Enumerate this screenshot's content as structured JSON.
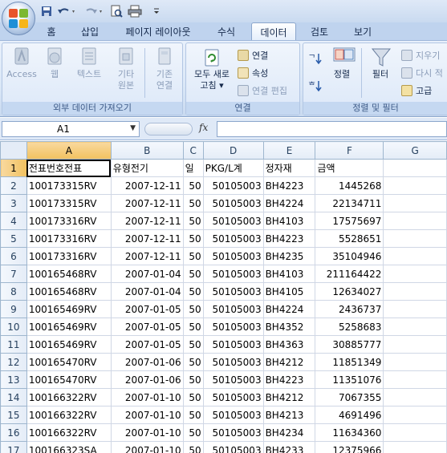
{
  "quick_access": [
    "save-icon",
    "undo-icon",
    "redo-icon",
    "print-preview-icon",
    "quick-print-icon",
    "customize-icon"
  ],
  "tabs": [
    {
      "label": "홈",
      "active": false
    },
    {
      "label": "삽입",
      "active": false
    },
    {
      "label": "페이지 레이아웃",
      "active": false
    },
    {
      "label": "수식",
      "active": false
    },
    {
      "label": "데이터",
      "active": true
    },
    {
      "label": "검토",
      "active": false
    },
    {
      "label": "보기",
      "active": false
    }
  ],
  "ribbon": {
    "external": {
      "label": "외부 데이터 가져오기",
      "access": "Access",
      "web": "웹",
      "text": "텍스트",
      "other_line1": "기타",
      "other_line2": "원본",
      "existing_line1": "기존",
      "existing_line2": "연결"
    },
    "connections": {
      "label": "연결",
      "refresh_line1": "모두 새로",
      "refresh_line2": "고침",
      "conn": "연결",
      "props": "속성",
      "edit_links": "연결 편집"
    },
    "sort": {
      "label": "정렬 및 필터",
      "sort": "정렬",
      "filter": "필터",
      "clear": "지우기",
      "reapply": "다시 적",
      "advanced": "고급"
    }
  },
  "formula_bar": {
    "namebox": "A1",
    "fx": "fx",
    "formula": ""
  },
  "columns": [
    "A",
    "B",
    "C",
    "D",
    "E",
    "F",
    "G"
  ],
  "rows": [
    {
      "n": "1",
      "a": "전표번호전표",
      "b": "유형전기",
      "c": "일",
      "d": "PKG/L계",
      "e": "정자재",
      "f": "금액"
    },
    {
      "n": "2",
      "a": "100173315RV",
      "b": "2007-12-11",
      "c": "50",
      "d": "50105003",
      "e": "BH4223",
      "f": "1445268"
    },
    {
      "n": "3",
      "a": "100173315RV",
      "b": "2007-12-11",
      "c": "50",
      "d": "50105003",
      "e": "BH4224",
      "f": "22134711"
    },
    {
      "n": "4",
      "a": "100173316RV",
      "b": "2007-12-11",
      "c": "50",
      "d": "50105003",
      "e": "BH4103",
      "f": "17575697"
    },
    {
      "n": "5",
      "a": "100173316RV",
      "b": "2007-12-11",
      "c": "50",
      "d": "50105003",
      "e": "BH4223",
      "f": "5528651"
    },
    {
      "n": "6",
      "a": "100173316RV",
      "b": "2007-12-11",
      "c": "50",
      "d": "50105003",
      "e": "BH4235",
      "f": "35104946"
    },
    {
      "n": "7",
      "a": "100165468RV",
      "b": "2007-01-04",
      "c": "50",
      "d": "50105003",
      "e": "BH4103",
      "f": "211164422"
    },
    {
      "n": "8",
      "a": "100165468RV",
      "b": "2007-01-04",
      "c": "50",
      "d": "50105003",
      "e": "BH4105",
      "f": "12634027"
    },
    {
      "n": "9",
      "a": "100165469RV",
      "b": "2007-01-05",
      "c": "50",
      "d": "50105003",
      "e": "BH4224",
      "f": "2436737"
    },
    {
      "n": "10",
      "a": "100165469RV",
      "b": "2007-01-05",
      "c": "50",
      "d": "50105003",
      "e": "BH4352",
      "f": "5258683"
    },
    {
      "n": "11",
      "a": "100165469RV",
      "b": "2007-01-05",
      "c": "50",
      "d": "50105003",
      "e": "BH4363",
      "f": "30885777"
    },
    {
      "n": "12",
      "a": "100165470RV",
      "b": "2007-01-06",
      "c": "50",
      "d": "50105003",
      "e": "BH4212",
      "f": "11851349"
    },
    {
      "n": "13",
      "a": "100165470RV",
      "b": "2007-01-06",
      "c": "50",
      "d": "50105003",
      "e": "BH4223",
      "f": "11351076"
    },
    {
      "n": "14",
      "a": "100166322RV",
      "b": "2007-01-10",
      "c": "50",
      "d": "50105003",
      "e": "BH4212",
      "f": "7067355"
    },
    {
      "n": "15",
      "a": "100166322RV",
      "b": "2007-01-10",
      "c": "50",
      "d": "50105003",
      "e": "BH4213",
      "f": "4691496"
    },
    {
      "n": "16",
      "a": "100166322RV",
      "b": "2007-01-10",
      "c": "50",
      "d": "50105003",
      "e": "BH4234",
      "f": "11634360"
    },
    {
      "n": "17",
      "a": "100166323SA",
      "b": "2007-01-10",
      "c": "50",
      "d": "50105003",
      "e": "BH4233",
      "f": "12375966"
    }
  ]
}
